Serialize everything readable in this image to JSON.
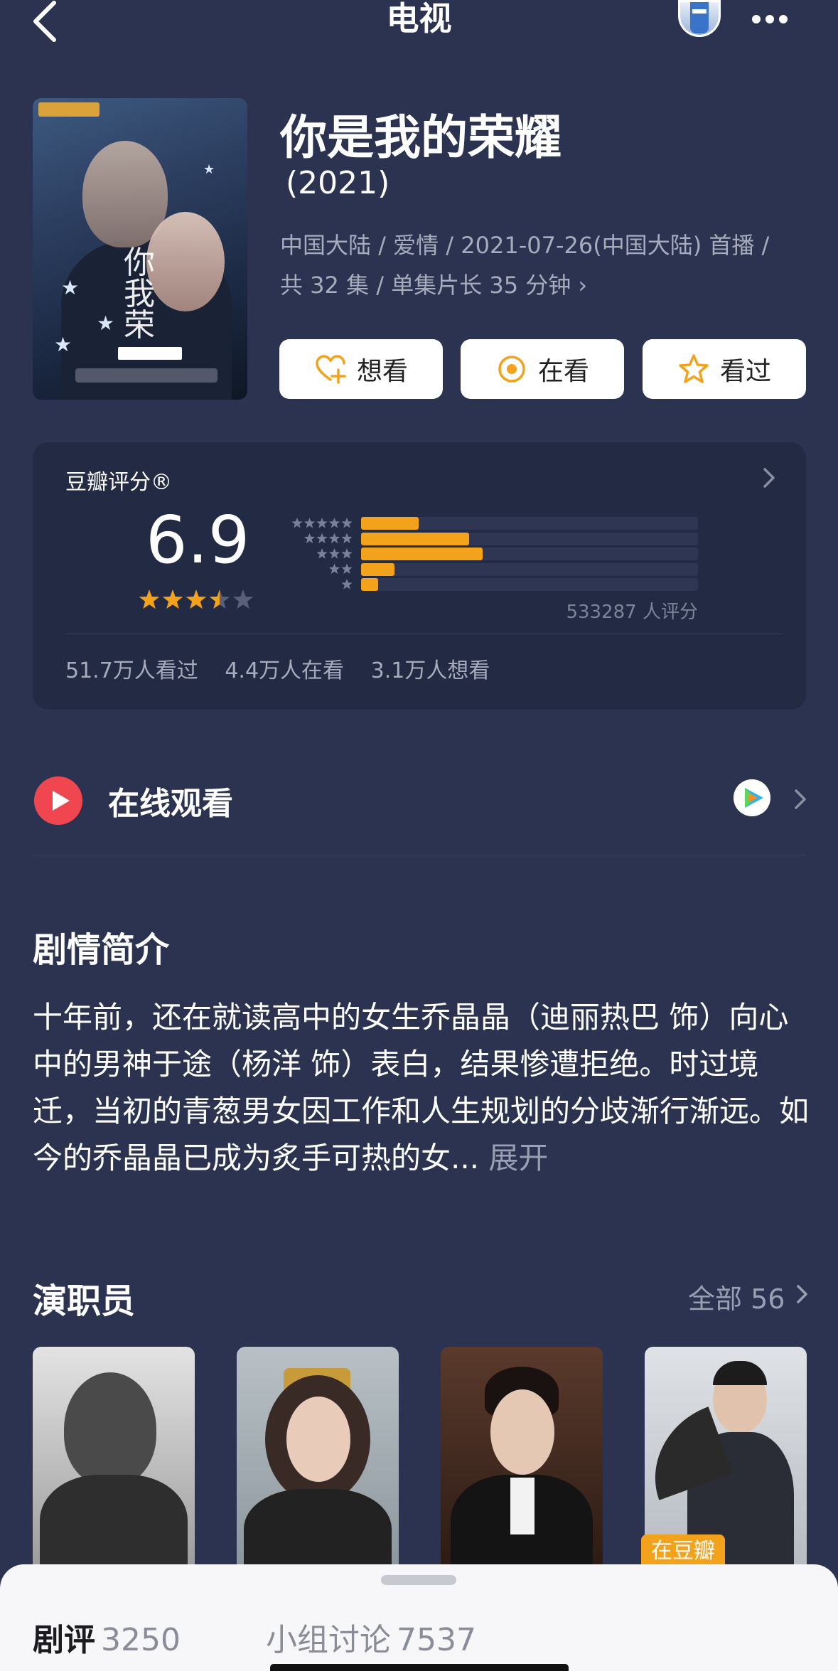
{
  "header": {
    "title": "电视"
  },
  "movie": {
    "title": "你是我的荣耀",
    "year": "(2021)",
    "meta_line1": "中国大陆 / 爱情 / 2021-07-26(中国大陆) 首播 /",
    "meta_line2": "共 32 集 / 单集片长 35 分钟 ›"
  },
  "actions": {
    "want": "想看",
    "watching": "在看",
    "watched": "看过"
  },
  "rating": {
    "label": "豆瓣评分®",
    "score": "6.9",
    "stars_out_of_5": 3.5,
    "distribution": [
      {
        "stars": 5,
        "fraction": 0.17
      },
      {
        "stars": 4,
        "fraction": 0.32
      },
      {
        "stars": 3,
        "fraction": 0.36
      },
      {
        "stars": 2,
        "fraction": 0.1
      },
      {
        "stars": 1,
        "fraction": 0.05
      }
    ],
    "votes": "533287 人评分",
    "watched": "51.7万人看过",
    "watching": "4.4万人在看",
    "want": "3.1万人想看"
  },
  "online": {
    "label": "在线观看"
  },
  "synopsis": {
    "title": "剧情简介",
    "text": "十年前，还在就读高中的女生乔晶晶（迪丽热巴 饰）向心中的男神于途（杨洋 饰）表白，结果惨遭拒绝。时过境迁，当初的青葱男女因工作和人生规划的分歧渐行渐远。如今的乔晶晶已成为炙手可热的女...",
    "expand": "展开"
  },
  "cast": {
    "title": "演职员",
    "all": "全部 56",
    "badge": "在豆瓣"
  },
  "bottom_tabs": {
    "reviews_label": "剧评",
    "reviews_count": "3250",
    "groups_label": "小组讨论",
    "groups_count": "7537"
  },
  "colors": {
    "background": "#2b3350",
    "accent": "#f3a21c",
    "card": "#232a43",
    "play": "#f04650"
  }
}
